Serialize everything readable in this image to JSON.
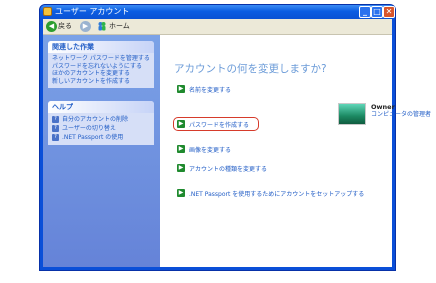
{
  "window": {
    "title": "ユーザー アカウント"
  },
  "toolbar": {
    "back_label": "戻る",
    "home_label": "ホーム"
  },
  "sidebar": {
    "related": {
      "title": "関連した作業",
      "links": [
        "ネットワーク パスワードを管理する",
        "パスワードを忘れないようにする",
        "ほかのアカウントを変更する",
        "新しいアカウントを作成する"
      ]
    },
    "help": {
      "title": "ヘルプ",
      "links": [
        "自分のアカウントの削除",
        "ユーザーの切り替え",
        ".NET Passport の使用"
      ]
    }
  },
  "main": {
    "heading": "アカウントの何を変更しますか?",
    "tasks": [
      "名前を変更する",
      "パスワードを作成する",
      "画像を変更する",
      "アカウントの種類を変更する",
      ".NET Passport を使用するためにアカウントをセットアップする"
    ],
    "account": {
      "name": "Owner",
      "role": "コンピュータの管理者"
    }
  },
  "colors": {
    "highlight": "#d63b2b",
    "link": "#215dc6",
    "task_arrow": "#1f8a2e"
  }
}
